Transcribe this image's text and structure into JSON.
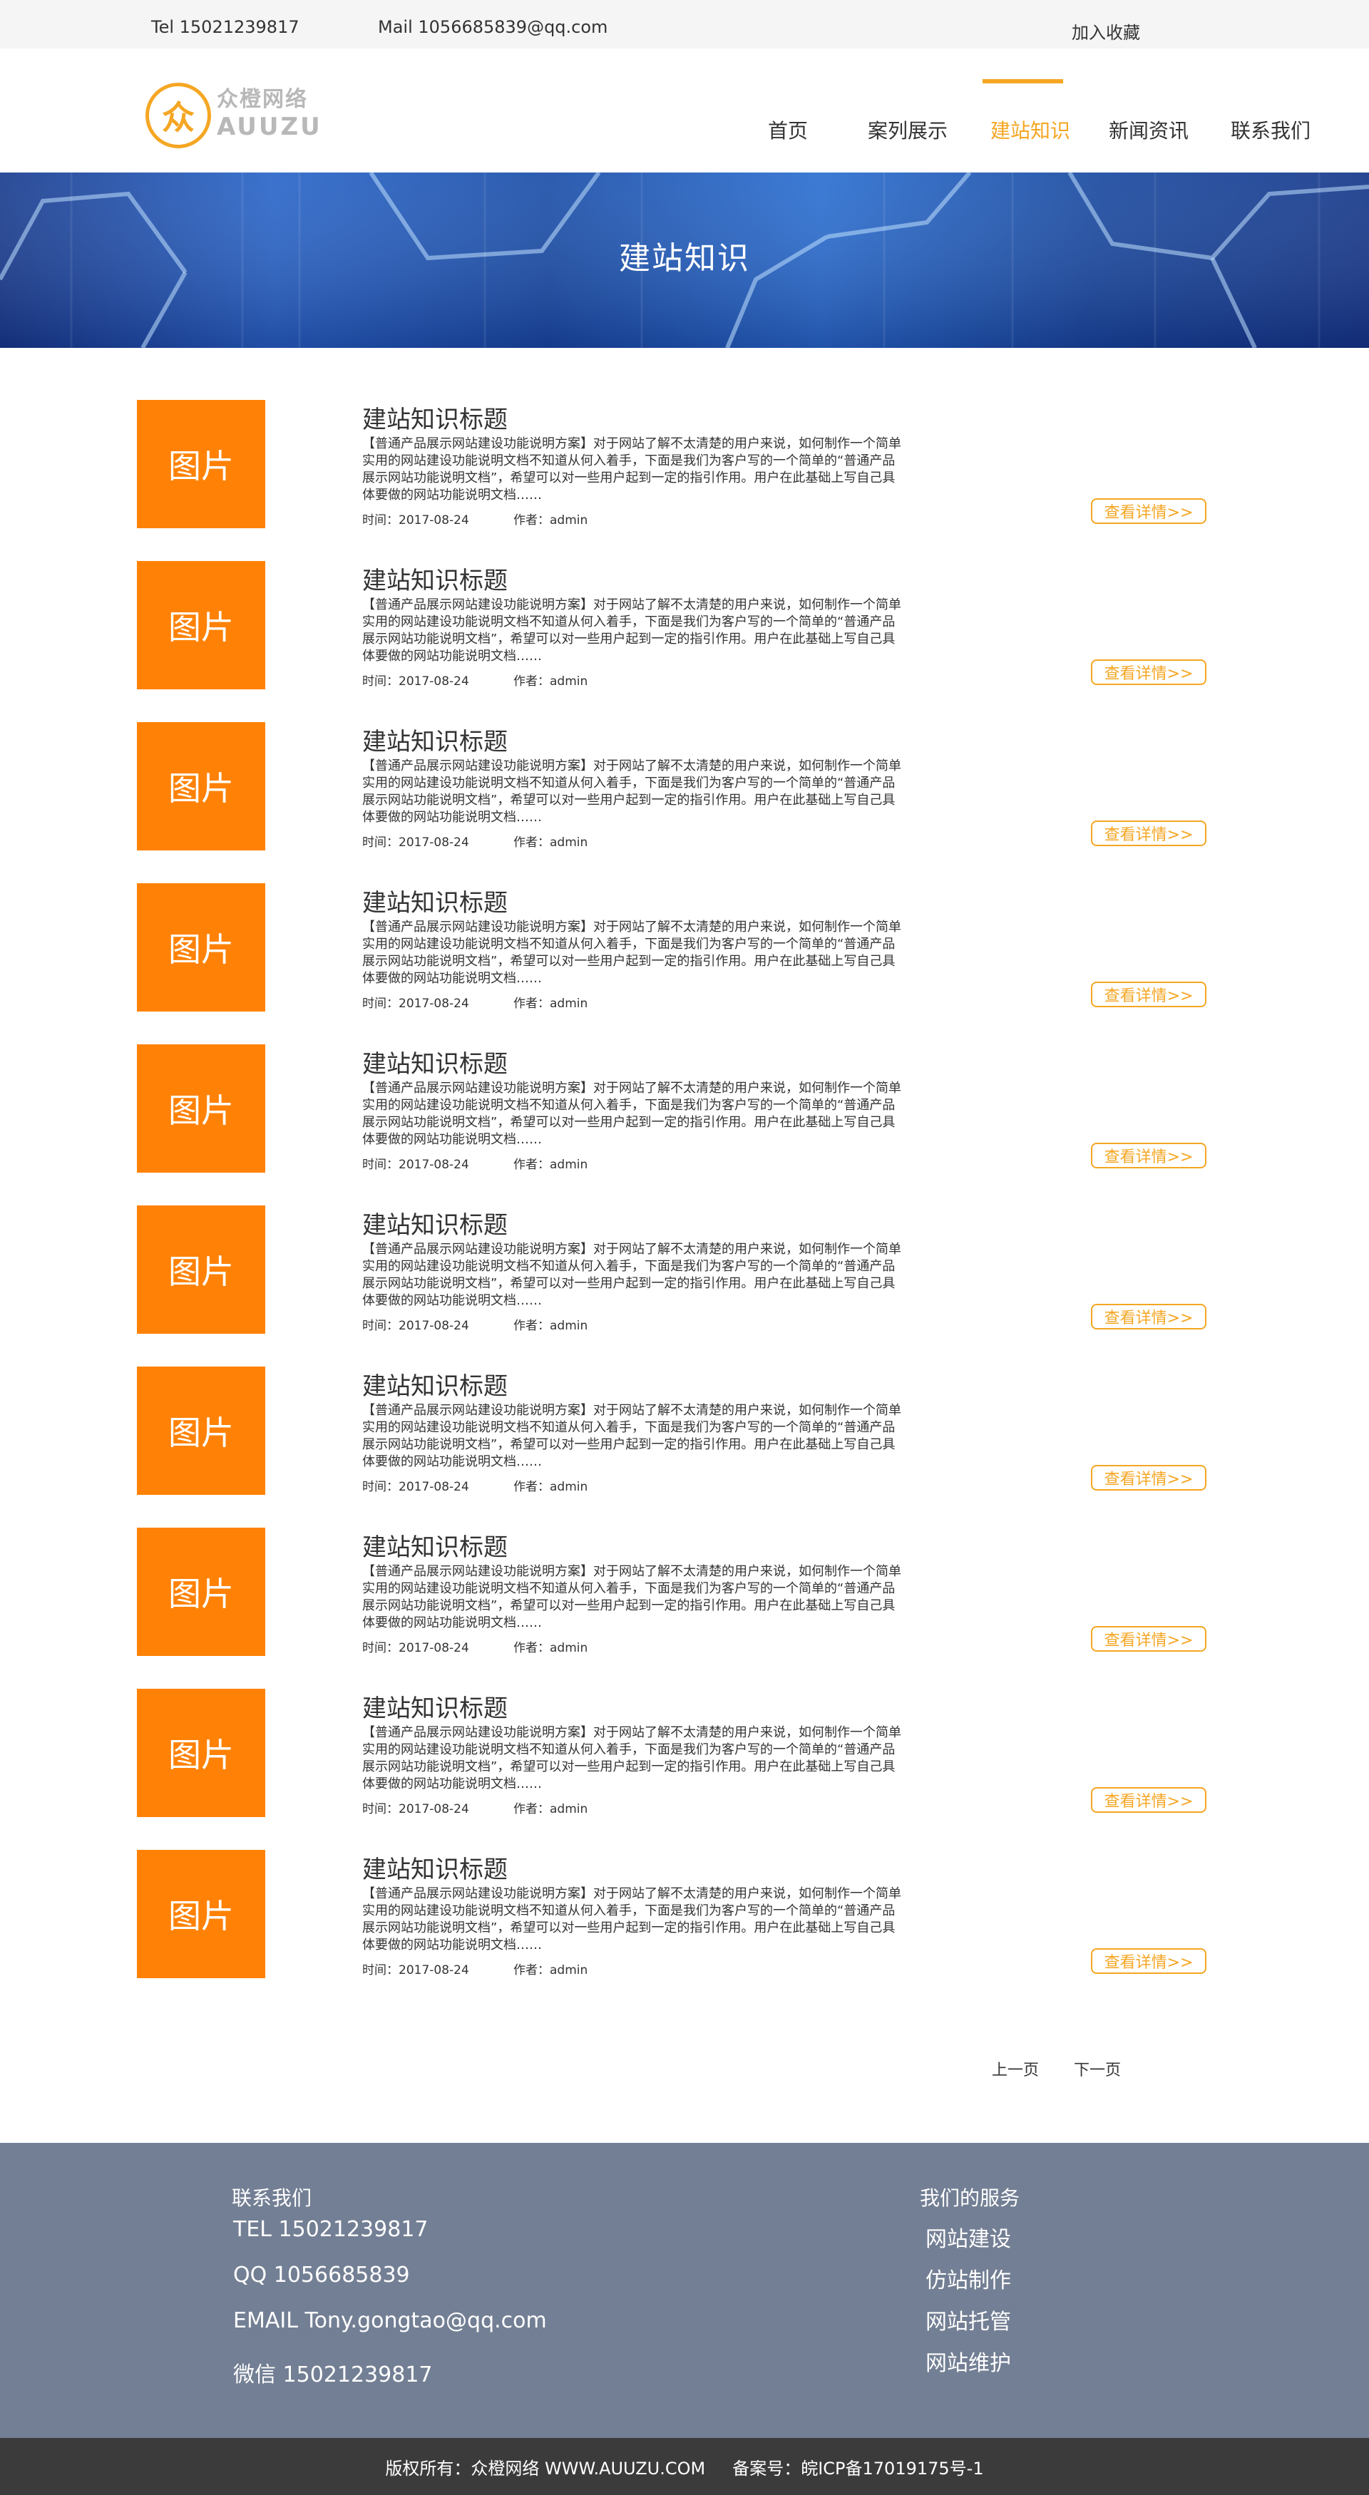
{
  "topbar": {
    "tel": "Tel 15021239817",
    "mail": "Mail 1056685839@qq.com",
    "favorite": "加入收藏"
  },
  "logo": {
    "mark": "众",
    "name_cn": "众橙网络",
    "name_en": "AUUZU"
  },
  "nav": {
    "items": [
      {
        "label": "首页"
      },
      {
        "label": "案列展示"
      },
      {
        "label": "建站知识"
      },
      {
        "label": "新闻资讯"
      },
      {
        "label": "联系我们"
      }
    ],
    "active_index": 2
  },
  "banner": {
    "title": "建站知识"
  },
  "articles": [
    {
      "image_label": "图片",
      "title": "建站知识标题",
      "desc": "【普通产品展示网站建设功能说明方案】对于网站了解不太清楚的用户来说，如何制作一个简单实用的网站建设功能说明文档不知道从何入着手，下面是我们为客户写的一个简单的“普通产品展示网站功能说明文档”，希望可以对一些用户起到一定的指引作用。用户在此基础上写自己具体要做的网站功能说明文档……",
      "time": "时间：2017-08-24",
      "author": "作者：admin",
      "button": "查看详情>>"
    },
    {
      "image_label": "图片",
      "title": "建站知识标题",
      "desc": "【普通产品展示网站建设功能说明方案】对于网站了解不太清楚的用户来说，如何制作一个简单实用的网站建设功能说明文档不知道从何入着手，下面是我们为客户写的一个简单的“普通产品展示网站功能说明文档”，希望可以对一些用户起到一定的指引作用。用户在此基础上写自己具体要做的网站功能说明文档……",
      "time": "时间：2017-08-24",
      "author": "作者：admin",
      "button": "查看详情>>"
    },
    {
      "image_label": "图片",
      "title": "建站知识标题",
      "desc": "【普通产品展示网站建设功能说明方案】对于网站了解不太清楚的用户来说，如何制作一个简单实用的网站建设功能说明文档不知道从何入着手，下面是我们为客户写的一个简单的“普通产品展示网站功能说明文档”，希望可以对一些用户起到一定的指引作用。用户在此基础上写自己具体要做的网站功能说明文档……",
      "time": "时间：2017-08-24",
      "author": "作者：admin",
      "button": "查看详情>>"
    },
    {
      "image_label": "图片",
      "title": "建站知识标题",
      "desc": "【普通产品展示网站建设功能说明方案】对于网站了解不太清楚的用户来说，如何制作一个简单实用的网站建设功能说明文档不知道从何入着手，下面是我们为客户写的一个简单的“普通产品展示网站功能说明文档”，希望可以对一些用户起到一定的指引作用。用户在此基础上写自己具体要做的网站功能说明文档……",
      "time": "时间：2017-08-24",
      "author": "作者：admin",
      "button": "查看详情>>"
    },
    {
      "image_label": "图片",
      "title": "建站知识标题",
      "desc": "【普通产品展示网站建设功能说明方案】对于网站了解不太清楚的用户来说，如何制作一个简单实用的网站建设功能说明文档不知道从何入着手，下面是我们为客户写的一个简单的“普通产品展示网站功能说明文档”，希望可以对一些用户起到一定的指引作用。用户在此基础上写自己具体要做的网站功能说明文档……",
      "time": "时间：2017-08-24",
      "author": "作者：admin",
      "button": "查看详情>>"
    },
    {
      "image_label": "图片",
      "title": "建站知识标题",
      "desc": "【普通产品展示网站建设功能说明方案】对于网站了解不太清楚的用户来说，如何制作一个简单实用的网站建设功能说明文档不知道从何入着手，下面是我们为客户写的一个简单的“普通产品展示网站功能说明文档”，希望可以对一些用户起到一定的指引作用。用户在此基础上写自己具体要做的网站功能说明文档……",
      "time": "时间：2017-08-24",
      "author": "作者：admin",
      "button": "查看详情>>"
    },
    {
      "image_label": "图片",
      "title": "建站知识标题",
      "desc": "【普通产品展示网站建设功能说明方案】对于网站了解不太清楚的用户来说，如何制作一个简单实用的网站建设功能说明文档不知道从何入着手，下面是我们为客户写的一个简单的“普通产品展示网站功能说明文档”，希望可以对一些用户起到一定的指引作用。用户在此基础上写自己具体要做的网站功能说明文档……",
      "time": "时间：2017-08-24",
      "author": "作者：admin",
      "button": "查看详情>>"
    },
    {
      "image_label": "图片",
      "title": "建站知识标题",
      "desc": "【普通产品展示网站建设功能说明方案】对于网站了解不太清楚的用户来说，如何制作一个简单实用的网站建设功能说明文档不知道从何入着手，下面是我们为客户写的一个简单的“普通产品展示网站功能说明文档”，希望可以对一些用户起到一定的指引作用。用户在此基础上写自己具体要做的网站功能说明文档……",
      "time": "时间：2017-08-24",
      "author": "作者：admin",
      "button": "查看详情>>"
    },
    {
      "image_label": "图片",
      "title": "建站知识标题",
      "desc": "【普通产品展示网站建设功能说明方案】对于网站了解不太清楚的用户来说，如何制作一个简单实用的网站建设功能说明文档不知道从何入着手，下面是我们为客户写的一个简单的“普通产品展示网站功能说明文档”，希望可以对一些用户起到一定的指引作用。用户在此基础上写自己具体要做的网站功能说明文档……",
      "time": "时间：2017-08-24",
      "author": "作者：admin",
      "button": "查看详情>>"
    },
    {
      "image_label": "图片",
      "title": "建站知识标题",
      "desc": "【普通产品展示网站建设功能说明方案】对于网站了解不太清楚的用户来说，如何制作一个简单实用的网站建设功能说明文档不知道从何入着手，下面是我们为客户写的一个简单的“普通产品展示网站功能说明文档”，希望可以对一些用户起到一定的指引作用。用户在此基础上写自己具体要做的网站功能说明文档……",
      "time": "时间：2017-08-24",
      "author": "作者：admin",
      "button": "查看详情>>"
    }
  ],
  "pagination": {
    "prev": "上一页",
    "next": "下一页"
  },
  "footer": {
    "contact_heading": "联系我们",
    "tel": "TEL 15021239817",
    "qq": "QQ 1056685839",
    "email": "EMAIL Tony.gongtao@qq.com",
    "wechat": "微信 15021239817",
    "services_heading": "我们的服务",
    "services": [
      "网站建设",
      "仿站制作",
      "网站托管",
      "网站维护"
    ]
  },
  "copyright": {
    "owner": "版权所有：众橙网络 WWW.AUUZU.COM",
    "icp": "备案号：皖ICP备17019175号-1"
  },
  "colors": {
    "accent": "#f5a623",
    "image_placeholder": "#ff8206",
    "footer_bg": "#737f94",
    "copyright_bg": "#3b3b3b"
  }
}
